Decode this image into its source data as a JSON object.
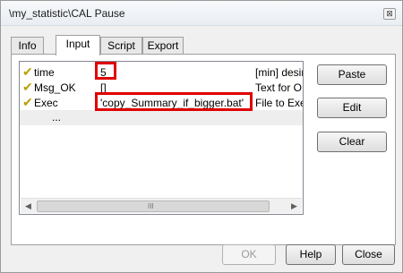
{
  "window": {
    "title": "\\my_statistic\\CAL Pause",
    "close_glyph": "⊠"
  },
  "tabs": [
    "Info",
    "Input",
    "Script",
    "Export"
  ],
  "active_tab": "Input",
  "params": [
    {
      "name": "time",
      "value": "5",
      "desc": "[min] desire"
    },
    {
      "name": "Msg_OK",
      "value": "[]",
      "desc": "Text for OK"
    },
    {
      "name": "Exec",
      "value": "'copy_Summary_if_bigger.bat'",
      "desc": "File to Exec"
    }
  ],
  "ellipsis_row": "...",
  "side_buttons": {
    "paste": "Paste",
    "edit": "Edit",
    "clear": "Clear"
  },
  "footer_buttons": {
    "ok": "OK",
    "help": "Help",
    "close": "Close"
  },
  "scrollbar": {
    "left": "◀",
    "right": "▶",
    "grip": "III"
  },
  "icons": {
    "check": "checkmark-icon"
  },
  "colors": {
    "highlight": "#e00000",
    "check": "#b8a000"
  }
}
